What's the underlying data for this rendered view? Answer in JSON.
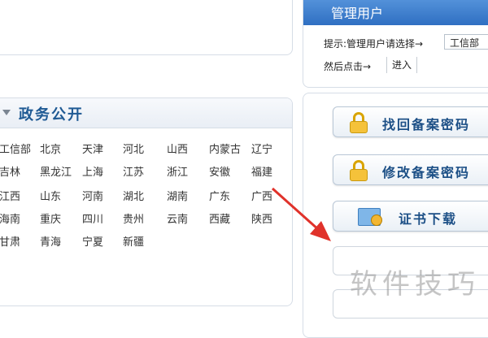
{
  "admin": {
    "title": "管理用户",
    "hint_label": "提示:管理用户请选择→",
    "dept_selected": "工信部",
    "then_label": "然后点击→",
    "enter_label": "进入"
  },
  "gov": {
    "title": "政务公开",
    "links": [
      "工信部",
      "北京",
      "天津",
      "河北",
      "山西",
      "内蒙古",
      "辽宁",
      "吉林",
      "黑龙江",
      "上海",
      "江苏",
      "浙江",
      "安徽",
      "福建",
      "江西",
      "山东",
      "河南",
      "湖北",
      "湖南",
      "广东",
      "广西",
      "海南",
      "重庆",
      "四川",
      "贵州",
      "云南",
      "西藏",
      "陕西",
      "甘肃",
      "青海",
      "宁夏",
      "新疆"
    ]
  },
  "buttons": {
    "recover_password": "找回备案密码",
    "modify_password": "修改备案密码",
    "cert_download": "证书下载"
  },
  "watermark": "软件技巧",
  "icons": {
    "gov_arrow": "triangle-down-icon",
    "lock": "lock-icon",
    "cert": "certificate-icon",
    "annotation": "red-arrow-icon"
  },
  "colors": {
    "header_blue": "#2f6fc2",
    "title_blue": "#1f5a94",
    "button_text": "#1c4f86",
    "arrow_red": "#e0322b"
  }
}
